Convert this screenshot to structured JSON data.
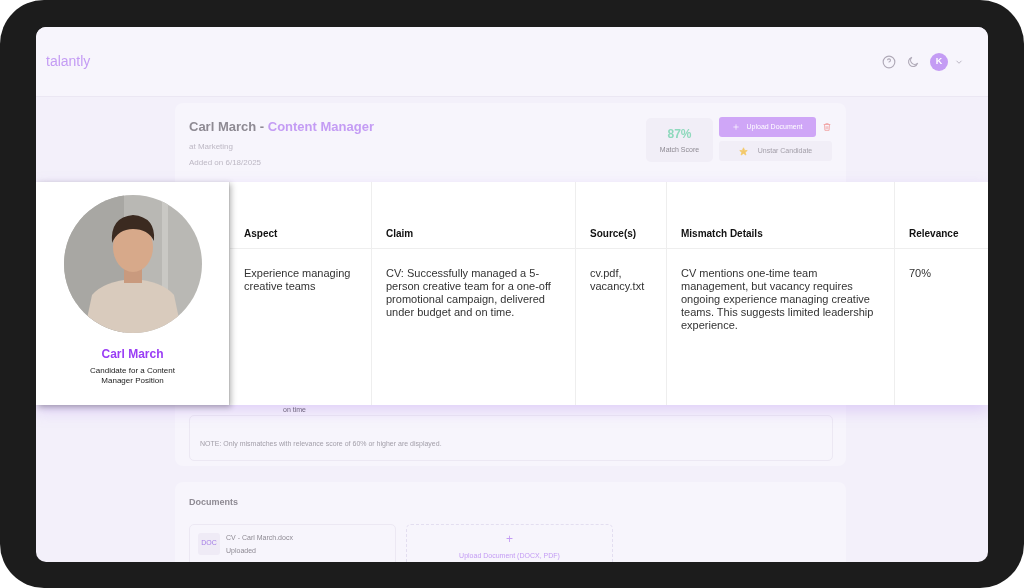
{
  "header": {
    "logo": "talantly",
    "avatar_initial": "K"
  },
  "candidate": {
    "name": "Carl March",
    "separator": " - ",
    "role": "Content Manager",
    "department": "at Marketing",
    "added": "Added on 6/18/2025",
    "match_score": "87%",
    "match_label": "Match Score",
    "upload_button": "Upload Document",
    "star_button": "Unstar Candidate",
    "starred": true
  },
  "mismatch_section": {
    "visible_fragment": "on time",
    "note": "NOTE: Only mismatches with relevance score of 60% or higher are displayed."
  },
  "documents": {
    "title": "Documents",
    "files": [
      {
        "badge": "DOC",
        "name": "CV - Carl March.docx",
        "status": "Uploaded"
      }
    ],
    "upload": {
      "icon": "+",
      "label": "Upload Document (DOCX, PDF)"
    }
  },
  "overlay": {
    "profile": {
      "name": "Carl March",
      "subtitle": "Candidate for a Content Manager Position"
    },
    "table": {
      "columns": [
        "Aspect",
        "Claim",
        "Source(s)",
        "Mismatch Details",
        "Relevance"
      ],
      "rows": [
        [
          "Experience managing creative teams",
          "CV: Successfully managed a 5-person creative team for a one-off promotional campaign, delivered under budget and on time.",
          "cv.pdf, vacancy.txt",
          "CV mentions one-time team management, but vacancy requires ongoing experience managing creative teams. This suggests limited leadership experience.",
          "70%"
        ]
      ]
    }
  }
}
